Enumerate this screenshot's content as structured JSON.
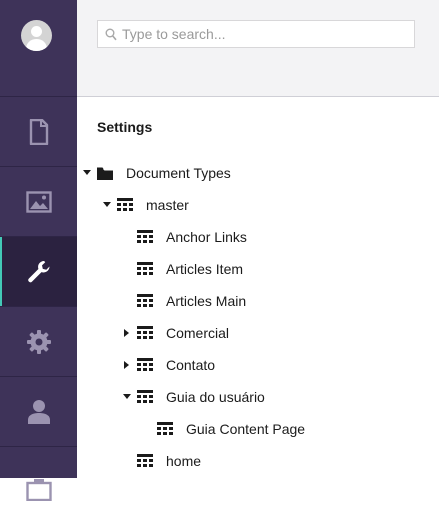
{
  "sidebar": {
    "avatar_icon": "user-avatar-icon",
    "items": [
      {
        "name": "content",
        "icon": "document-icon",
        "active": false
      },
      {
        "name": "media",
        "icon": "image-icon",
        "active": false
      },
      {
        "name": "settings",
        "icon": "wrench-icon",
        "active": true
      },
      {
        "name": "developer",
        "icon": "gear-icon",
        "active": false
      },
      {
        "name": "users",
        "icon": "person-icon",
        "active": false
      },
      {
        "name": "members",
        "icon": "members-icon",
        "active": false
      }
    ],
    "bg_color": "#3e3359",
    "active_color": "#2b2240",
    "accent_color": "#43c9b7"
  },
  "search": {
    "placeholder": "Type to search..."
  },
  "tree": {
    "title": "Settings",
    "nodes": [
      {
        "label": "Document Types",
        "icon": "folder-icon",
        "expanded": true
      },
      {
        "label": "master",
        "icon": "doctype-icon",
        "expanded": true
      },
      {
        "label": "Anchor Links",
        "icon": "doctype-icon"
      },
      {
        "label": "Articles Item",
        "icon": "doctype-icon"
      },
      {
        "label": "Articles Main",
        "icon": "doctype-icon"
      },
      {
        "label": "Comercial",
        "icon": "doctype-icon",
        "expanded": false
      },
      {
        "label": "Contato",
        "icon": "doctype-icon",
        "expanded": false
      },
      {
        "label": "Guia do usuário",
        "icon": "doctype-icon",
        "expanded": true
      },
      {
        "label": "Guia Content Page",
        "icon": "doctype-icon"
      },
      {
        "label": "home",
        "icon": "doctype-icon"
      }
    ]
  }
}
